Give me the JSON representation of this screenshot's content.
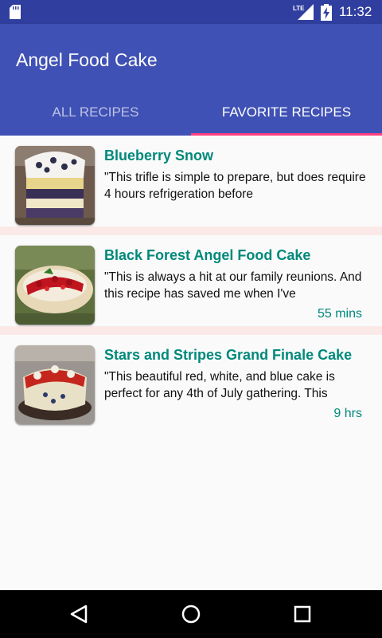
{
  "status_bar": {
    "time": "11:32",
    "network": "LTE",
    "icons": [
      "sd-card-icon",
      "lte-signal-icon",
      "battery-charging-icon"
    ]
  },
  "app_bar": {
    "title": "Angel Food Cake",
    "background": "#3f51b5"
  },
  "tabs": [
    {
      "label": "ALL RECIPES",
      "selected": false
    },
    {
      "label": "FAVORITE RECIPES",
      "selected": true
    }
  ],
  "accent_color": "#ff4081",
  "title_color": "#00897b",
  "recipes": [
    {
      "title": "Blueberry Snow",
      "description": "\"This trifle is simple to prepare, but does require 4 hours refrigeration before",
      "time": ""
    },
    {
      "title": "Black Forest Angel Food Cake",
      "description": "\"This is always a hit at our family reunions. And this recipe has saved me when I've",
      "time": "55 mins"
    },
    {
      "title": "Stars and Stripes Grand Finale Cake",
      "description": "\"This beautiful red, white, and blue cake is perfect for any 4th of July gathering. This",
      "time": "9 hrs"
    }
  ],
  "nav_bar": {
    "icons": [
      "back-icon",
      "home-icon",
      "recents-icon"
    ]
  }
}
